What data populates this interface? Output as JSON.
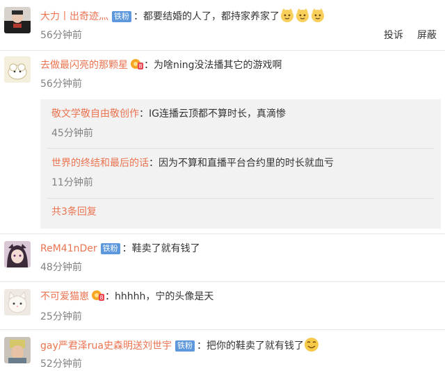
{
  "comments": [
    {
      "username": "大力丨出奇迹灬",
      "badge": "铁粉",
      "text": "都要结婚的人了，都持家养家了",
      "emoji": "cat-face-emoji",
      "time": "56分钟前",
      "actions": [
        "投诉",
        "屏蔽"
      ]
    },
    {
      "username": "去做最闪亮的那颗星",
      "text": "为啥ning没法播其它的游戏啊",
      "time": "56分钟前",
      "replies": [
        {
          "username": "敬文学敬自由敬创作",
          "text": "IG连播云顶都不算时长，真滴惨",
          "time": "45分钟前"
        },
        {
          "username": "世界的终结和最后的话",
          "text": "因为不算和直播平台合约里的时长就血亏",
          "time": "11分钟前"
        }
      ],
      "more_replies": "共3条回复"
    },
    {
      "username": "ReM41nDer",
      "badge": "铁粉",
      "text": "鞋卖了就有钱了",
      "time": "48分钟前"
    },
    {
      "username": "不可爱猫崽",
      "text": "hhhhh，宁的头像是天",
      "time": "25分钟前"
    },
    {
      "username": "gay严君泽rua史森明送刘世宇",
      "badge": "铁粉",
      "text": "把你的鞋卖了就有钱了",
      "time": "52分钟前"
    }
  ],
  "colors": {
    "username": "#eb7350",
    "badge": "#5d98dc",
    "time": "#808080",
    "reply_bg": "#f2f2f2"
  }
}
